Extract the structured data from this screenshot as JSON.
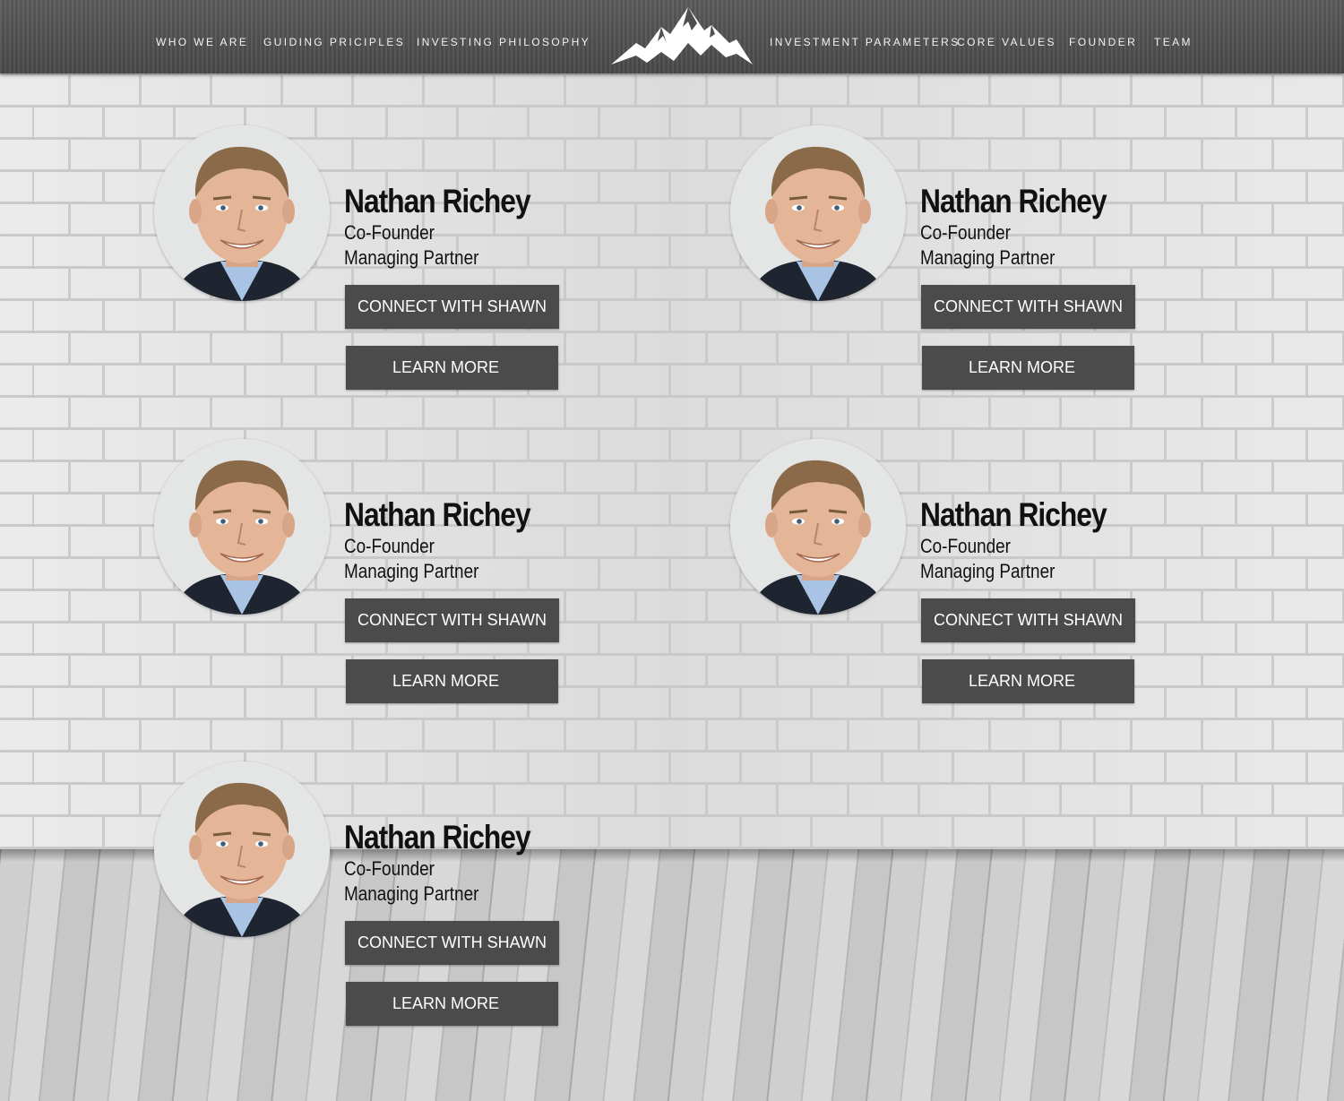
{
  "nav": {
    "left": [
      "WHO WE ARE",
      "GUIDING PRICIPLES",
      "INVESTING PHILOSOPHY"
    ],
    "right": [
      "INVESTMENT PARAMETERS",
      "CORE VALUES",
      "FOUNDER",
      "TEAM"
    ],
    "logo_icon": "mountain-logo-icon"
  },
  "team": [
    {
      "name": "Nathan Richey",
      "role1": "Co-Founder",
      "role2": "Managing Partner",
      "connect": "CONNECT WITH SHAWN",
      "learn": "LEARN MORE"
    },
    {
      "name": "Nathan Richey",
      "role1": "Co-Founder",
      "role2": "Managing Partner",
      "connect": "CONNECT WITH SHAWN",
      "learn": "LEARN MORE"
    },
    {
      "name": "Nathan Richey",
      "role1": "Co-Founder",
      "role2": "Managing Partner",
      "connect": "CONNECT WITH SHAWN",
      "learn": "LEARN MORE"
    },
    {
      "name": "Nathan Richey",
      "role1": "Co-Founder",
      "role2": "Managing Partner",
      "connect": "CONNECT WITH SHAWN",
      "learn": "LEARN MORE"
    },
    {
      "name": "Nathan Richey",
      "role1": "Co-Founder",
      "role2": "Managing Partner",
      "connect": "CONNECT WITH SHAWN",
      "learn": "LEARN MORE"
    }
  ],
  "colors": {
    "nav_bg": "#4f4f4f",
    "button_bg": "#4b4b4b",
    "text": "#111111"
  }
}
